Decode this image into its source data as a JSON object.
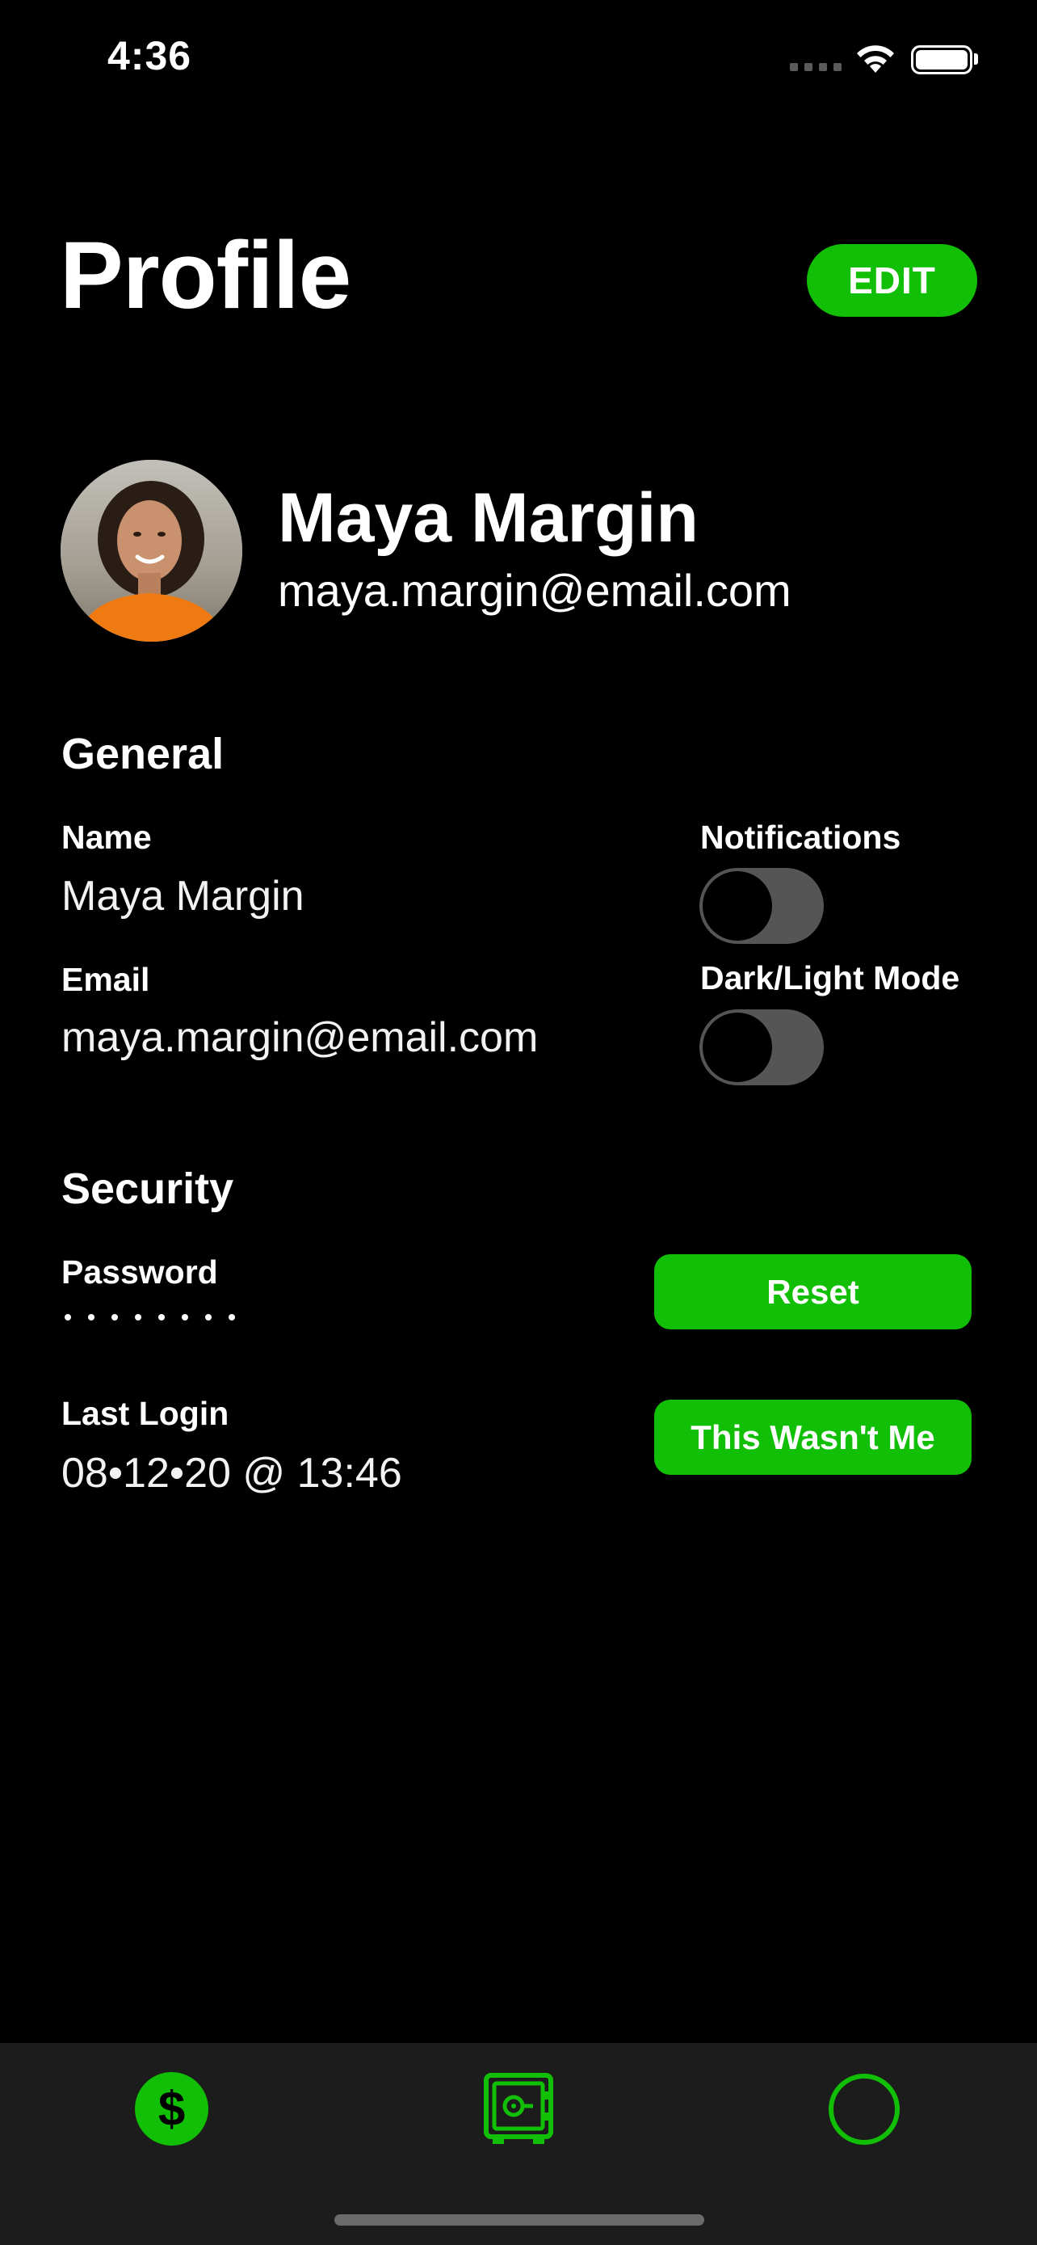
{
  "status_bar": {
    "time": "4:36"
  },
  "header": {
    "title": "Profile",
    "edit_label": "EDIT"
  },
  "profile": {
    "name": "Maya Margin",
    "email": "maya.margin@email.com"
  },
  "general": {
    "title": "General",
    "name_label": "Name",
    "name_value": "Maya Margin",
    "email_label": "Email",
    "email_value": "maya.margin@email.com",
    "notifications_label": "Notifications",
    "notifications_on": false,
    "dark_light_label": "Dark/Light Mode",
    "dark_light_on": false
  },
  "security": {
    "title": "Security",
    "password_label": "Password",
    "reset_label": "Reset",
    "last_login_label": "Last Login",
    "last_login_value": "08•12•20 @ 13:46",
    "not_me_label": "This Wasn't Me"
  },
  "tab_bar": {
    "items": [
      {
        "icon": "dollar-icon",
        "glyph": "$"
      },
      {
        "icon": "safe-icon"
      },
      {
        "icon": "circle-icon"
      }
    ]
  },
  "colors": {
    "accent": "#11bf06",
    "background": "#000000",
    "tab_bar": "#1c1c1c",
    "toggle_off": "#555555"
  }
}
